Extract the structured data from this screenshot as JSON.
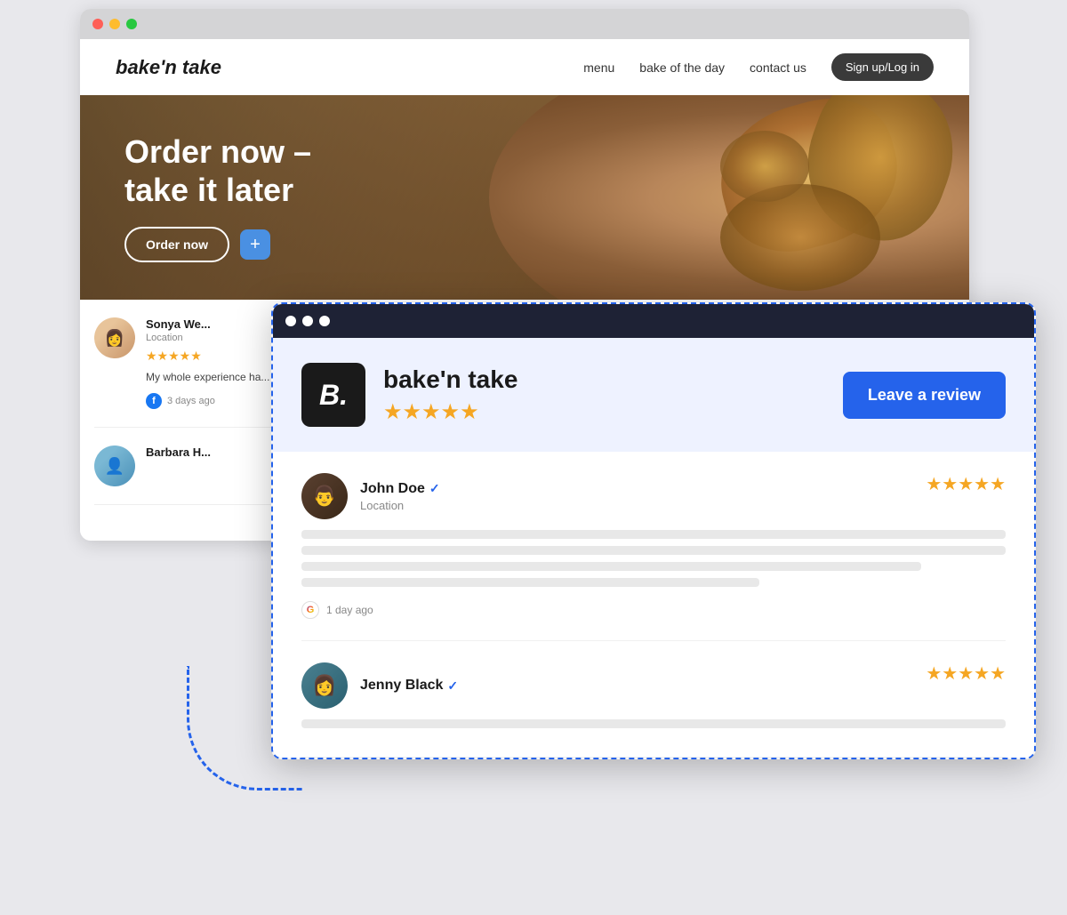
{
  "bg_browser": {
    "nav": {
      "logo": "bake'n take",
      "links": [
        "menu",
        "bake of the day",
        "contact us"
      ],
      "signup_btn": "Sign up/Log in"
    },
    "hero": {
      "title": "Order now –\ntake it later",
      "order_btn": "Order now",
      "plus_btn": "+"
    },
    "sidebar_reviews": [
      {
        "name": "Sonya We...",
        "location": "Location",
        "stars": "★★★★★",
        "text": "My whole experience ha... ordered a sampling of M... and I have loved it all. Th... beef stand out as... Re...",
        "platform": "Facebook",
        "time_ago": "3 days ago"
      },
      {
        "name": "Barbara H...",
        "location": "",
        "stars": "",
        "text": ""
      }
    ]
  },
  "fg_browser": {
    "biz": {
      "logo_letter": "B.",
      "name": "bake'n take",
      "stars": "★★★★★",
      "leave_review_btn": "Leave a review"
    },
    "reviews": [
      {
        "name": "John Doe",
        "verified": true,
        "location": "Location",
        "stars": "★★★★★",
        "platform": "Google",
        "time_ago": "1 day ago"
      },
      {
        "name": "Jenny Black",
        "verified": true,
        "location": "",
        "stars": "★★★★★",
        "platform": "",
        "time_ago": ""
      }
    ]
  },
  "icons": {
    "verified": "✓",
    "google": "G",
    "facebook": "f",
    "star": "★"
  },
  "colors": {
    "accent_blue": "#2563eb",
    "star_gold": "#f5a623",
    "dark_nav": "#1e2235",
    "biz_logo_bg": "#1a1a1a"
  }
}
